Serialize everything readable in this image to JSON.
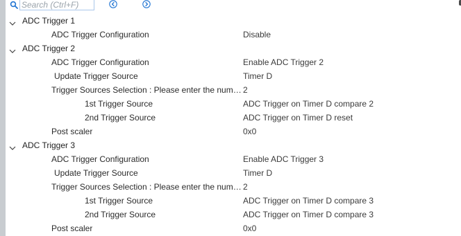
{
  "search": {
    "placeholder": "Search (Ctrl+F)",
    "value": ""
  },
  "icons": {
    "search": "search-icon",
    "prev": "circle-chevron-left-icon",
    "next": "circle-chevron-right-icon",
    "expand": "chevron-down-icon"
  },
  "colors": {
    "accent": "#1e73d2",
    "panel_border": "#c8ccd0",
    "text": "#2b2b2b"
  },
  "groups": [
    {
      "label": "ADC Trigger 1",
      "expanded": true,
      "params": [
        {
          "name": "ADC Trigger Configuration",
          "value": "Disable"
        }
      ]
    },
    {
      "label": "ADC Trigger 2",
      "expanded": true,
      "params": [
        {
          "name": "ADC Trigger Configuration",
          "value": "Enable ADC Trigger 2"
        },
        {
          "name": "Update Trigger Source",
          "value": "Timer D"
        },
        {
          "name": "Trigger Sources Selection : Please enter the number of sources",
          "value": "2"
        },
        {
          "name": "1st Trigger Source",
          "value": "ADC Trigger on Timer D compare 2"
        },
        {
          "name": "2nd Trigger Source",
          "value": "ADC Trigger on Timer D reset"
        },
        {
          "name": "Post scaler",
          "value": "0x0"
        }
      ]
    },
    {
      "label": "ADC Trigger 3",
      "expanded": true,
      "params": [
        {
          "name": "ADC Trigger Configuration",
          "value": "Enable ADC Trigger 3"
        },
        {
          "name": "Update Trigger Source",
          "value": "Timer D"
        },
        {
          "name": "Trigger Sources Selection : Please enter the number of sources",
          "value": "2"
        },
        {
          "name": "1st Trigger Source",
          "value": "ADC Trigger on Timer D compare 3"
        },
        {
          "name": "2nd Trigger Source",
          "value": "ADC Trigger on Timer D compare 3"
        },
        {
          "name": "Post scaler",
          "value": "0x0"
        }
      ]
    }
  ]
}
